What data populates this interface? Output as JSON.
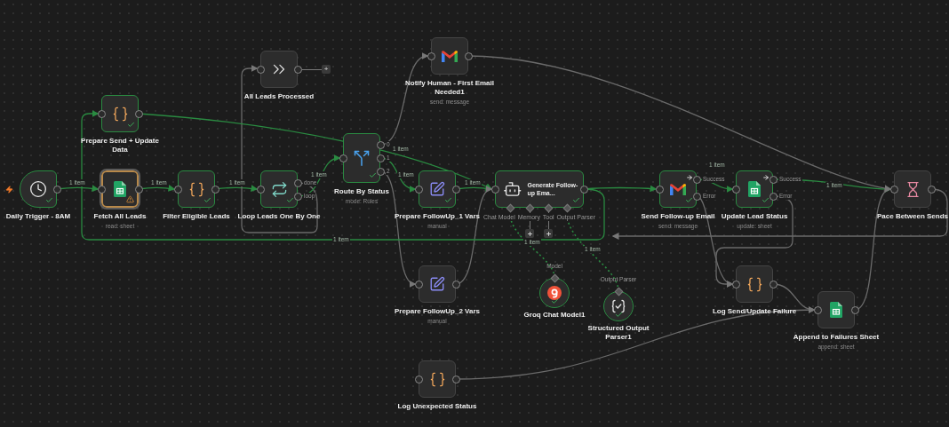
{
  "nodes": [
    {
      "kind": "schedule",
      "title": "Daily Trigger - 8AM",
      "success": true,
      "selected": false,
      "warning": false
    },
    {
      "kind": "sheets",
      "title": "Fetch All Leads",
      "subtitle": "read: sheet",
      "success": false,
      "selected": true,
      "warning": true
    },
    {
      "kind": "code",
      "title": "Filter Eligible Leads",
      "success": true,
      "selected": false,
      "warning": false
    },
    {
      "kind": "noop",
      "title": "All Leads Processed",
      "success": false,
      "selected": false,
      "warning": false,
      "ports": [
        {
          "label": "+",
          "connected": false
        }
      ]
    },
    {
      "kind": "loop",
      "title": "Loop Leads One By One",
      "success": true,
      "selected": false,
      "warning": false,
      "ports": [
        {
          "label": "done"
        },
        {
          "label": "loop"
        }
      ]
    },
    {
      "kind": "code",
      "title": "Prepare Send + Update Data",
      "success": true,
      "selected": false,
      "warning": false
    },
    {
      "kind": "switch",
      "title": "Route By Status",
      "subtitle": "mode: Rules",
      "success": true,
      "selected": false,
      "warning": false,
      "ports": [
        {
          "label": "0"
        },
        {
          "label": "1"
        },
        {
          "label": "2"
        }
      ]
    },
    {
      "kind": "gmail",
      "title": "Notify Human - First Email Needed1",
      "subtitle": "send: message",
      "success": false,
      "selected": false,
      "warning": false
    },
    {
      "kind": "set",
      "title": "Prepare FollowUp_1 Vars",
      "subtitle": "manual",
      "success": true,
      "selected": false,
      "warning": false
    },
    {
      "kind": "agent",
      "title": "Generate Follow-up Ema...",
      "success": true,
      "selected": false,
      "warning": false,
      "ports": [
        {
          "label": "Chat Model",
          "connected": true
        },
        {
          "label": "Memory",
          "connected": false
        },
        {
          "label": "Tool",
          "connected": false
        },
        {
          "label": "Output Parser",
          "connected": true
        }
      ]
    },
    {
      "kind": "set",
      "title": "Prepare FollowUp_2 Vars",
      "subtitle": "manual",
      "success": false,
      "selected": false,
      "warning": false
    },
    {
      "kind": "groq",
      "title": "Groq Chat Model1",
      "success": true,
      "selected": false,
      "warning": false,
      "ports": [
        {
          "label": "Model"
        }
      ]
    },
    {
      "kind": "parser",
      "title": "Structured Output Parser1",
      "success": true,
      "selected": false,
      "warning": false,
      "ports": [
        {
          "label": "Output Parser"
        }
      ]
    },
    {
      "kind": "gmail",
      "title": "Send Follow-up Email",
      "subtitle": "send: message",
      "success": true,
      "selected": false,
      "warning": false,
      "ports": [
        {
          "label": "Success"
        },
        {
          "label": "Error"
        }
      ]
    },
    {
      "kind": "sheets",
      "title": "Update Lead Status",
      "subtitle": "update: sheet",
      "success": true,
      "selected": false,
      "warning": false,
      "ports": [
        {
          "label": "Success"
        },
        {
          "label": "Error"
        }
      ]
    },
    {
      "kind": "wait",
      "title": "Pace Between Sends",
      "success": false,
      "selected": false,
      "warning": false
    },
    {
      "kind": "code",
      "title": "Log Send/Update Failure",
      "success": false,
      "selected": false,
      "warning": false
    },
    {
      "kind": "sheets",
      "title": "Append to Failures Sheet",
      "subtitle": "append: sheet",
      "success": false,
      "selected": false,
      "warning": false
    },
    {
      "kind": "code",
      "title": "Log Unexpected Status",
      "success": false,
      "selected": false,
      "warning": false
    }
  ],
  "connections": [
    {
      "kind": "main",
      "label": "1 item",
      "success": true
    },
    {
      "kind": "main",
      "label": "1 item",
      "success": true
    },
    {
      "kind": "main",
      "label": "1 item",
      "success": true
    },
    {
      "kind": "main",
      "success": false
    },
    {
      "kind": "main",
      "label": "1 item",
      "success": true
    },
    {
      "kind": "main",
      "success": false
    },
    {
      "kind": "main",
      "label": "1 item",
      "success": true
    },
    {
      "kind": "main",
      "label": "1 item",
      "success": true
    },
    {
      "kind": "main",
      "success": false
    },
    {
      "kind": "main",
      "label": "1 item",
      "success": true
    },
    {
      "kind": "main",
      "success": false
    },
    {
      "kind": "main",
      "success": true
    },
    {
      "kind": "main",
      "label": "1 item",
      "success": true
    },
    {
      "kind": "main",
      "label": "1 item",
      "success": true
    },
    {
      "kind": "main",
      "success": false
    },
    {
      "kind": "main",
      "success": false
    },
    {
      "kind": "main",
      "success": false
    },
    {
      "kind": "main",
      "success": false
    },
    {
      "kind": "main",
      "success": false
    },
    {
      "kind": "main",
      "success": false
    },
    {
      "kind": "main",
      "label": "1 item",
      "success": true
    },
    {
      "kind": "main",
      "success": false
    },
    {
      "kind": "ai",
      "label": "1 item",
      "success": true
    },
    {
      "kind": "ai",
      "label": "1 item",
      "success": true
    }
  ]
}
